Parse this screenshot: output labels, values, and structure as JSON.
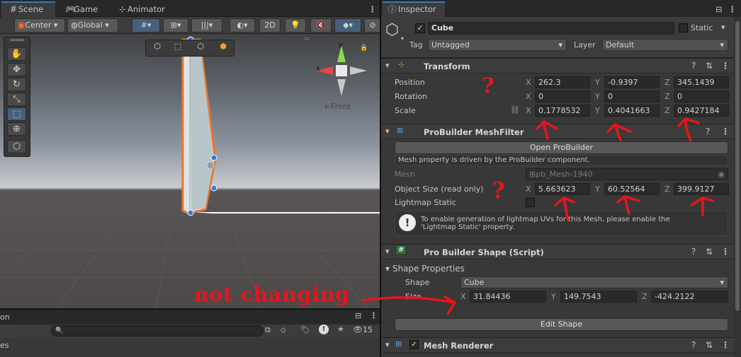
{
  "scene_tabs": {
    "scene": "Scene",
    "game": "Game",
    "animator": "Animator"
  },
  "scene_toolbar": {
    "pivot": "Center",
    "space": "Global",
    "mode_2d": "2D"
  },
  "gizmo": {
    "view_label": "Front",
    "axes": [
      "x",
      "y"
    ]
  },
  "bottom_panel": {
    "tab_partial": "on",
    "row_partial": "es",
    "hidden_count": "15"
  },
  "inspector": {
    "tab": "Inspector",
    "object_name": "Cube",
    "static_label": "Static",
    "tag_label": "Tag",
    "tag_value": "Untagged",
    "layer_label": "Layer",
    "layer_value": "Default",
    "transform": {
      "title": "Transform",
      "position_label": "Position",
      "rotation_label": "Rotation",
      "scale_label": "Scale",
      "position": {
        "x": "262.3",
        "y": "-0.9397",
        "z": "345.1439"
      },
      "rotation": {
        "x": "0",
        "y": "0",
        "z": "0"
      },
      "scale": {
        "x": "0.1778532",
        "y": "0.4041663",
        "z": "0.9427184"
      }
    },
    "meshfilter": {
      "title": "ProBuilder MeshFilter",
      "open_button": "Open ProBuilder",
      "driven_note": "Mesh property is driven by the ProBuilder component.",
      "mesh_label": "Mesh",
      "mesh_value": "pb_Mesh-1940",
      "size_label": "Object Size (read only)",
      "size": {
        "x": "5.663623",
        "y": "60.52564",
        "z": "399.9127"
      },
      "lightmap_label": "Lightmap Static",
      "info_line1": "To enable generation of lightmap UVs for this Mesh, please enable the",
      "info_line2": "'Lightmap Static' property."
    },
    "shape": {
      "title": "Pro Builder Shape (Script)",
      "props_label": "Shape Properties",
      "shape_label": "Shape",
      "shape_value": "Cube",
      "size_label": "Size",
      "size": {
        "x": "31.84436",
        "y": "149.7543",
        "z": "-424.2122"
      },
      "edit_button": "Edit Shape"
    },
    "renderer": {
      "title": "Mesh Renderer"
    }
  },
  "annotation": {
    "text": "not changing",
    "q": "?"
  },
  "colors": {
    "selection": "#e8782d",
    "annotation": "#e8141e",
    "handle": "#3a78e0"
  }
}
